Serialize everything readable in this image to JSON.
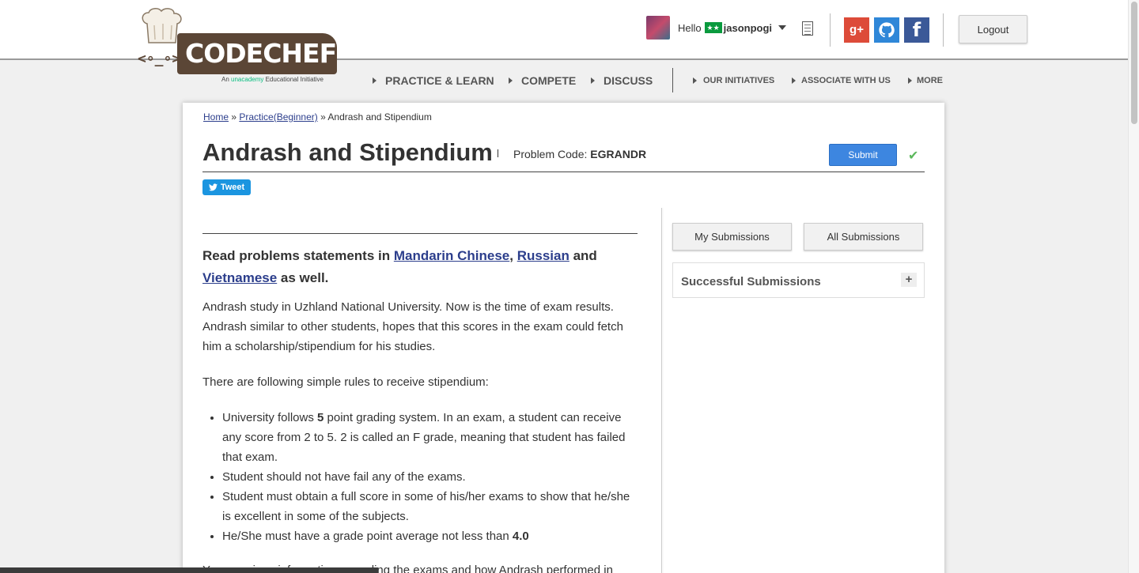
{
  "logo": {
    "word": "CODECHEF",
    "face": "<∘_∘>",
    "tagline_prefix": "An ",
    "tagline_brand": "unacademy",
    "tagline_suffix": " Educational Initiative"
  },
  "header": {
    "hello": "Hello",
    "flag_text": "★★",
    "username": "jasonpogi",
    "logout_label": "Logout",
    "social": {
      "gplus": "g+",
      "facebook": "f"
    }
  },
  "nav": {
    "main": [
      "PRACTICE & LEARN",
      "COMPETE",
      "DISCUSS"
    ],
    "secondary": [
      "OUR INITIATIVES",
      "ASSOCIATE WITH US",
      "MORE"
    ]
  },
  "breadcrumb": {
    "home": "Home",
    "sep1": " » ",
    "practice": "Practice(Beginner)",
    "sep2": " » ",
    "current": "Andrash and Stipendium"
  },
  "problem": {
    "title": "Andrash and Stipendium",
    "code_label": "Problem Code: ",
    "code": "EGRANDR",
    "submit_label": "Submit",
    "check": "✔",
    "tweet_label": "Tweet"
  },
  "statement": {
    "read_prefix": "Read problems statements in ",
    "lang1": "Mandarin Chinese",
    "comma": ", ",
    "lang2": "Russian",
    "and": " and ",
    "lang3": "Vietnamese",
    "read_suffix": " as well.",
    "p1": "Andrash study in Uzhland National University. Now is the time of exam results. Andrash similar to other students, hopes that this scores in the exam could fetch him a scholarship/stipendium for his studies.",
    "p2": "There are following simple rules to receive stipendium:",
    "rule1_a": "University follows ",
    "rule1_b": "5",
    "rule1_c": " point grading system. In an exam, a student can receive any score from 2 to 5. 2 is called an F grade, meaning that student has failed that exam.",
    "rule2": "Student should not have fail any of the exams.",
    "rule3": "Student must obtain a full score in some of his/her exams to show that he/she is excellent in some of the subjects.",
    "rule4_a": "He/She must have a grade point average not less than ",
    "rule4_b": "4.0",
    "p3": "You are given information regarding the exams and how Andrash performed in"
  },
  "sidebar": {
    "my_submissions": "My Submissions",
    "all_submissions": "All Submissions",
    "successful": "Successful Submissions",
    "expand": "+"
  }
}
